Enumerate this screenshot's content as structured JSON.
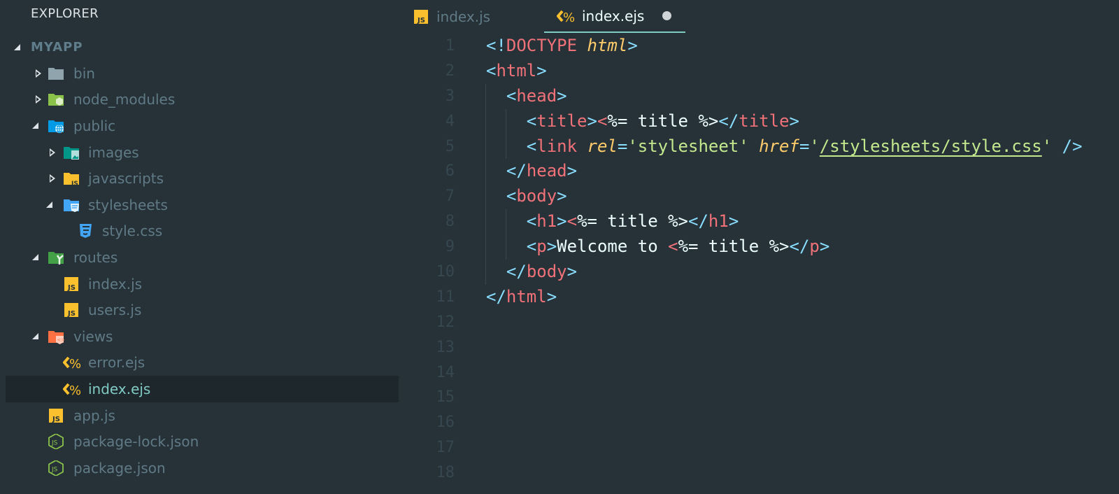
{
  "sidebar": {
    "title": "EXPLORER",
    "root": "MYAPP",
    "items": [
      {
        "label": "bin",
        "depth": 0,
        "arrow": "closed",
        "icon": "folder"
      },
      {
        "label": "node_modules",
        "depth": 0,
        "arrow": "closed",
        "icon": "folder-node"
      },
      {
        "label": "public",
        "depth": 0,
        "arrow": "open",
        "icon": "folder-public"
      },
      {
        "label": "images",
        "depth": 1,
        "arrow": "closed",
        "icon": "folder-images"
      },
      {
        "label": "javascripts",
        "depth": 1,
        "arrow": "closed",
        "icon": "folder-js"
      },
      {
        "label": "stylesheets",
        "depth": 1,
        "arrow": "open",
        "icon": "folder-css"
      },
      {
        "label": "style.css",
        "depth": 2,
        "arrow": "none",
        "icon": "css-file"
      },
      {
        "label": "routes",
        "depth": 0,
        "arrow": "open",
        "icon": "folder-routes"
      },
      {
        "label": "index.js",
        "depth": 1,
        "arrow": "none",
        "icon": "js-file"
      },
      {
        "label": "users.js",
        "depth": 1,
        "arrow": "none",
        "icon": "js-file"
      },
      {
        "label": "views",
        "depth": 0,
        "arrow": "open",
        "icon": "folder-views"
      },
      {
        "label": "error.ejs",
        "depth": 1,
        "arrow": "none",
        "icon": "ejs-file"
      },
      {
        "label": "index.ejs",
        "depth": 1,
        "arrow": "none",
        "icon": "ejs-file",
        "selected": true
      },
      {
        "label": "app.js",
        "depth": 0,
        "arrow": "none",
        "icon": "js-file"
      },
      {
        "label": "package-lock.json",
        "depth": 0,
        "arrow": "none",
        "icon": "node-json-file"
      },
      {
        "label": "package.json",
        "depth": 0,
        "arrow": "none",
        "icon": "node-json-file"
      }
    ]
  },
  "tabs": [
    {
      "label": "index.js",
      "icon": "js-file",
      "active": false
    },
    {
      "label": "index.ejs",
      "icon": "ejs-file",
      "active": true,
      "dirty": true
    }
  ],
  "editor": {
    "line_numbers": [
      "1",
      "2",
      "3",
      "4",
      "5",
      "6",
      "7",
      "8",
      "9",
      "10",
      "11",
      "12",
      "13",
      "14",
      "15",
      "16",
      "17",
      "18"
    ],
    "lines": [
      {
        "indent": 0,
        "tokens": [
          [
            "p",
            "<!"
          ],
          [
            "tag",
            "DOCTYPE"
          ],
          [
            "txt",
            " "
          ],
          [
            "attr",
            "html"
          ],
          [
            "p",
            ">"
          ]
        ]
      },
      {
        "indent": 0,
        "tokens": [
          [
            "p",
            "<"
          ],
          [
            "tag",
            "html"
          ],
          [
            "p",
            ">"
          ]
        ]
      },
      {
        "indent": 1,
        "tokens": [
          [
            "p",
            "<"
          ],
          [
            "tag",
            "head"
          ],
          [
            "p",
            ">"
          ]
        ]
      },
      {
        "indent": 2,
        "tokens": [
          [
            "p",
            "<"
          ],
          [
            "tag",
            "title"
          ],
          [
            "p",
            ">"
          ],
          [
            "ejs",
            "<"
          ],
          [
            "txt",
            "%= title %>"
          ],
          [
            "p",
            "</"
          ],
          [
            "tag",
            "title"
          ],
          [
            "p",
            ">"
          ]
        ]
      },
      {
        "indent": 2,
        "tokens": [
          [
            "p",
            "<"
          ],
          [
            "tag",
            "link"
          ],
          [
            "txt",
            " "
          ],
          [
            "attr",
            "rel"
          ],
          [
            "p",
            "="
          ],
          [
            "str",
            "'stylesheet'"
          ],
          [
            "txt",
            " "
          ],
          [
            "attr",
            "href"
          ],
          [
            "p",
            "="
          ],
          [
            "str",
            "'"
          ],
          [
            "str-link",
            "/stylesheets/style.css"
          ],
          [
            "str",
            "'"
          ],
          [
            "txt",
            " "
          ],
          [
            "p",
            "/>"
          ]
        ]
      },
      {
        "indent": 1,
        "tokens": [
          [
            "p",
            "</"
          ],
          [
            "tag",
            "head"
          ],
          [
            "p",
            ">"
          ]
        ]
      },
      {
        "indent": 1,
        "tokens": [
          [
            "p",
            "<"
          ],
          [
            "tag",
            "body"
          ],
          [
            "p",
            ">"
          ]
        ]
      },
      {
        "indent": 2,
        "tokens": [
          [
            "p",
            "<"
          ],
          [
            "tag",
            "h1"
          ],
          [
            "p",
            ">"
          ],
          [
            "ejs",
            "<"
          ],
          [
            "txt",
            "%= title %>"
          ],
          [
            "p",
            "</"
          ],
          [
            "tag",
            "h1"
          ],
          [
            "p",
            ">"
          ]
        ]
      },
      {
        "indent": 2,
        "tokens": [
          [
            "p",
            "<"
          ],
          [
            "tag",
            "p"
          ],
          [
            "p",
            ">"
          ],
          [
            "txt",
            "Welcome to "
          ],
          [
            "ejs",
            "<"
          ],
          [
            "txt",
            "%= title %>"
          ],
          [
            "p",
            "</"
          ],
          [
            "tag",
            "p"
          ],
          [
            "p",
            ">"
          ]
        ]
      },
      {
        "indent": 1,
        "tokens": [
          [
            "p",
            "</"
          ],
          [
            "tag",
            "body"
          ],
          [
            "p",
            ">"
          ]
        ]
      },
      {
        "indent": 0,
        "tokens": [
          [
            "p",
            "</"
          ],
          [
            "tag",
            "html"
          ],
          [
            "p",
            ">"
          ]
        ]
      }
    ]
  }
}
